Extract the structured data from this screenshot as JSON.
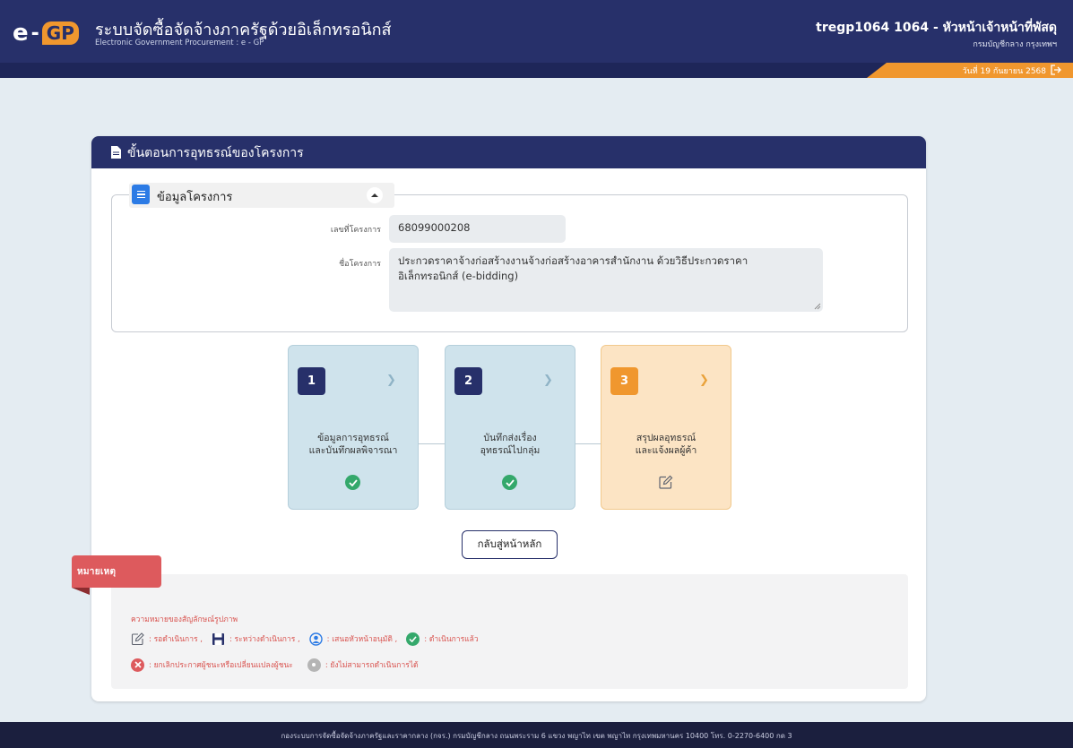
{
  "header": {
    "logo_e": "e",
    "logo_gp": "GP",
    "title": "ระบบจัดซื้อจัดจ้างภาครัฐด้วยอิเล็กทรอนิกส์",
    "subtitle": "Electronic Government Procurement : e - GP",
    "user": "tregp1064 1064 - หัวหน้าเจ้าหน้าที่พัสดุ",
    "department": "กรมบัญชีกลาง กรุงเทพฯ",
    "date": "วันที่ 19 กันยายน 2568",
    "logout_icon": "logout-icon"
  },
  "card": {
    "title": "ขั้นตอนการอุทธรณ์ของโครงการ",
    "icon": "document-icon"
  },
  "project": {
    "section_title": "ข้อมูลโครงการ",
    "project_no_label": "เลขที่โครงการ",
    "project_no": "68099000208",
    "project_name_label": "ชื่อโครงการ",
    "project_name_line1": "ประกวดราคาจ้างก่อสร้างงานจ้างก่อสร้างอาคารสำนักงาน ด้วยวิธีประกวดราคา",
    "project_name_line2": "อิเล็กทรอนิกส์ (e-bidding)"
  },
  "steps": [
    {
      "number": "1",
      "label_line1": "ข้อมูลการอุทธรณ์",
      "label_line2": "และบันทึกผลพิจารณา",
      "status": "done"
    },
    {
      "number": "2",
      "label_line1": "บันทึกส่งเรื่อง",
      "label_line2": "อุทธรณ์ไปกลุ่ม",
      "status": "done"
    },
    {
      "number": "3",
      "label_line1": "สรุปผลอุทธรณ์",
      "label_line2": "และแจ้งผลผู้ค้า",
      "status": "pending"
    }
  ],
  "buttons": {
    "home": "กลับสู่หน้าหลัก"
  },
  "notes": {
    "ribbon": "หมายเหตุ",
    "heading": "ความหมายของสัญลักษณ์รูปภาพ",
    "pending": ": รอดำเนินการ ,",
    "in_progress": ": ระหว่างดำเนินการ ,",
    "propose": ": เสนอหัวหน้าอนุมัติ ,",
    "done": ": ดำเนินการแล้ว",
    "cancel": ": ยกเลิกประกาศผู้ชนะหรือเปลี่ยนแปลงผู้ชนะ",
    "unavailable": ": ยังไม่สามารถดำเนินการได้"
  },
  "footer": {
    "text": "กองระบบการจัดซื้อจัดจ้างภาครัฐและราคากลาง (กจร.) กรมบัญชีกลาง ถนนพระราม 6 แขวง พญาไท เขต พญาไท กรุงเทพมหานคร 10400 โทร. 0-2270-6400 กด 3"
  },
  "colors": {
    "navy": "#27306a",
    "orange": "#f0972e",
    "green": "#34a86b",
    "red": "#dd5a5d",
    "blue": "#2c7be5"
  }
}
